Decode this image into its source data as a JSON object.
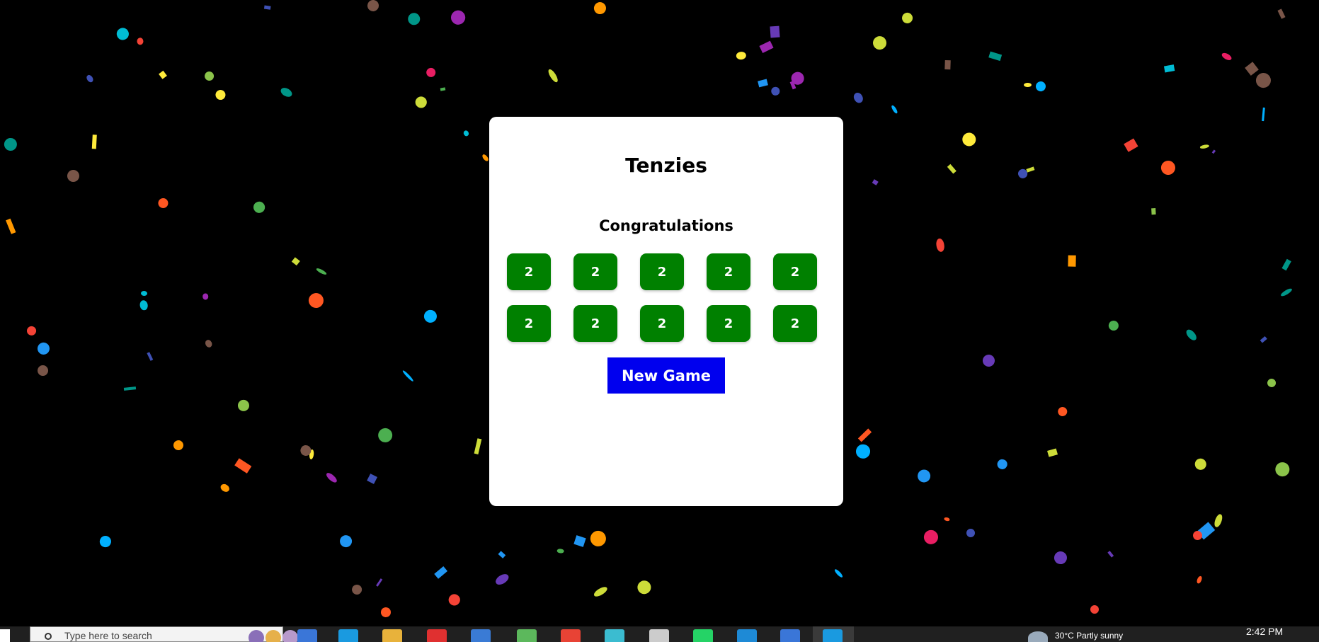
{
  "game": {
    "title": "Tenzies",
    "status_message": "Congratulations",
    "dice_values": [
      2,
      2,
      2,
      2,
      2,
      2,
      2,
      2,
      2,
      2
    ],
    "new_game_label": "New Game"
  },
  "taskbar": {
    "search_placeholder": "Type here to search",
    "time": "2:42 PM",
    "weather_text": "30°C Partly sunny"
  },
  "colors": {
    "background": "#000000",
    "card": "#ffffff",
    "die": "#008000",
    "die_text": "#ffffff",
    "button": "#0000ee",
    "taskbar": "#202020"
  },
  "confetti_palette": [
    "#ff5722",
    "#00b0ff",
    "#ffeb3b",
    "#8bc34a",
    "#9c27b0",
    "#e91e63",
    "#00bcd4",
    "#795548",
    "#4caf50",
    "#ff9800",
    "#3f51b5",
    "#2196f3",
    "#673ab7",
    "#f44336",
    "#cddc39",
    "#009688"
  ],
  "taskbar_icon_colors": [
    "#3a76d8",
    "#1a9ae0",
    "#e8b23b",
    "#e03030",
    "#3a7bd5",
    "#5cb85c",
    "#e84335",
    "#3bbcd0",
    "#cccccc",
    "#25d366",
    "#1e8ad6"
  ]
}
